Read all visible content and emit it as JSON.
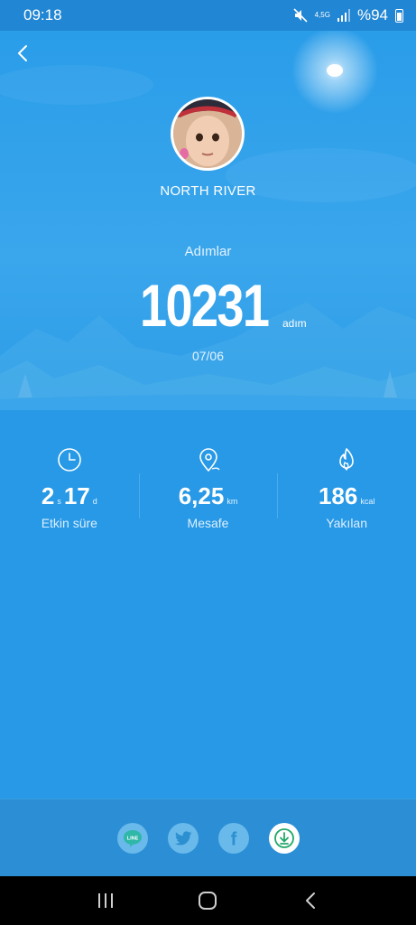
{
  "status_bar": {
    "time": "09:18",
    "network": "4,5G",
    "battery": "%94"
  },
  "user": {
    "name": "NORTH RIVER"
  },
  "steps": {
    "label": "Adımlar",
    "value": "10231",
    "unit": "adım",
    "date": "07/06"
  },
  "stats": [
    {
      "icon": "clock-icon",
      "value_a": "2",
      "unit_a": "s",
      "value_b": "17",
      "unit_b": "d",
      "label": "Etkin süre"
    },
    {
      "icon": "location-pin-icon",
      "value": "6,25",
      "unit": "km",
      "label": "Mesafe"
    },
    {
      "icon": "flame-icon",
      "value": "186",
      "unit": "kcal",
      "label": "Yakılan"
    }
  ],
  "share": [
    {
      "icon": "line-icon",
      "label": "LINE"
    },
    {
      "icon": "twitter-icon"
    },
    {
      "icon": "facebook-icon",
      "label": "f"
    },
    {
      "icon": "download-icon"
    }
  ],
  "colors": {
    "primary": "#2799e6",
    "status_bar": "#2186d3",
    "share_bar": "#2c8fd6"
  }
}
